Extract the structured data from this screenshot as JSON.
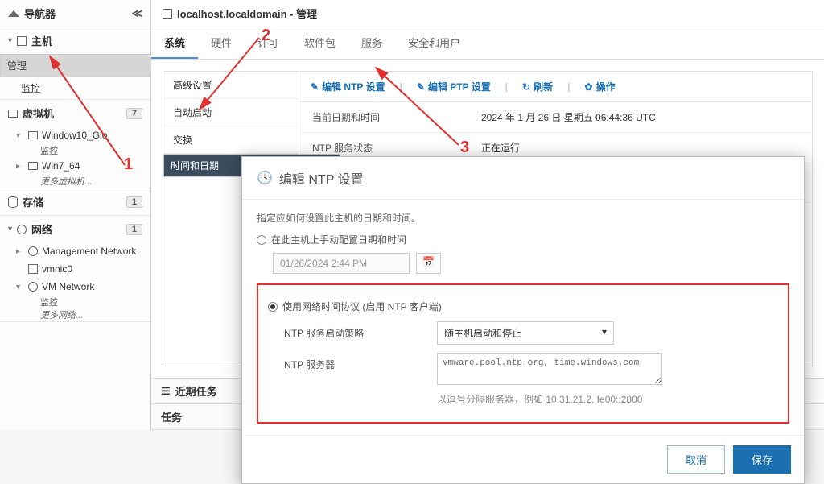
{
  "sidebar": {
    "header": "导航器",
    "section_host": "主机",
    "host_items": [
      "管理",
      "监控"
    ],
    "section_vm": "虚拟机",
    "vm_badge": "7",
    "vms": [
      {
        "name": "Window10_Glo",
        "child": "监控"
      },
      {
        "name": "Win7_64"
      }
    ],
    "vm_more": "更多虚拟机...",
    "section_storage": "存储",
    "storage_badge": "1",
    "section_network": "网络",
    "network_badge": "1",
    "nets": [
      {
        "name": "Management Network"
      },
      {
        "name": "vmnic0"
      },
      {
        "name": "VM Network",
        "child": "监控"
      }
    ],
    "net_more": "更多网络..."
  },
  "main": {
    "title": "localhost.localdomain - 管理",
    "tabs": [
      "系统",
      "硬件",
      "许可",
      "软件包",
      "服务",
      "安全和用户"
    ],
    "subnav": [
      "高级设置",
      "自动启动",
      "交换",
      "时间和日期"
    ],
    "toolbar": {
      "edit_ntp": "编辑 NTP 设置",
      "edit_ptp": "编辑 PTP 设置",
      "refresh": "刷新",
      "actions": "操作"
    },
    "info": [
      {
        "label": "当前日期和时间",
        "value": "2024 年 1 月 26 日 星期五 06:44:36 UTC"
      },
      {
        "label": "NTP 服务状态",
        "value": "正在运行"
      },
      {
        "label": "NTP 服务器",
        "value": "vmware.pool.ntp.org\ntime.windows.com"
      }
    ],
    "bottom": {
      "recent": "近期任务",
      "tasks": "任务"
    }
  },
  "dialog": {
    "title": "编辑 NTP 设置",
    "desc": "指定应如何设置此主机的日期和时间。",
    "opt_manual": "在此主机上手动配置日期和时间",
    "dt_value": "01/26/2024 2:44 PM",
    "opt_ntp": "使用网络时间协议 (启用 NTP 客户端)",
    "policy_label": "NTP 服务启动策略",
    "policy_value": "随主机启动和停止",
    "servers_label": "NTP 服务器",
    "servers_value": "vmware.pool.ntp.org, time.windows.com",
    "servers_help": "以逗号分隔服务器，例如 10.31.21.2, fe00::2800",
    "cancel": "取消",
    "save": "保存"
  },
  "annotations": {
    "n1": "1",
    "n2": "2",
    "n3": "3"
  }
}
